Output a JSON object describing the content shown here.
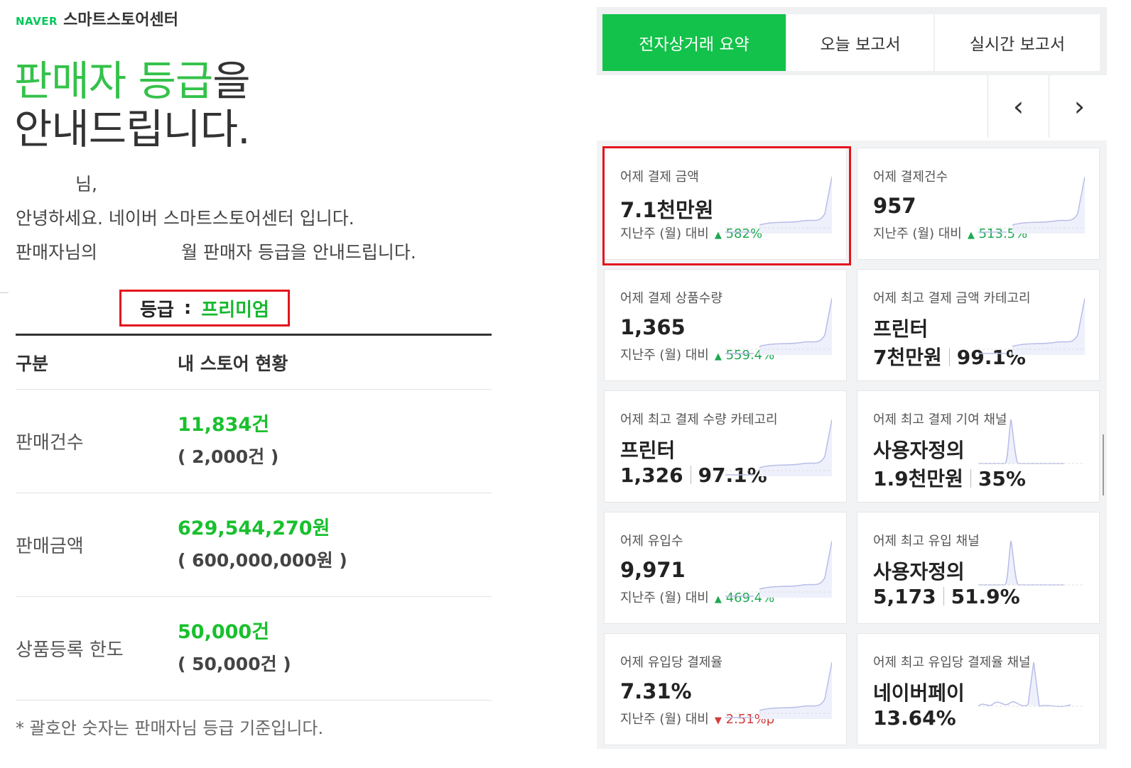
{
  "left": {
    "brand_naver": "NAVER",
    "brand_center": "스마트스토어센터",
    "headline_line1_green": "판매자 등급",
    "headline_line1_rest": "을",
    "headline_line2": "안내드립니다.",
    "greeting_name_suffix": "님,",
    "greeting_line2": "안녕하세요. 네이버 스마트스토어센터 입니다.",
    "greeting_line3_prefix": "판매자님의",
    "greeting_line3_suffix": "월 판매자 등급을 안내드립니다.",
    "grade_label": "등급",
    "grade_colon": ":",
    "grade_value": "프리미엄",
    "table": {
      "col1": "구분",
      "col2": "내 스토어 현황",
      "rows": [
        {
          "label": "판매건수",
          "value": "11,834건",
          "criteria": "( 2,000건 )"
        },
        {
          "label": "판매금액",
          "value": "629,544,270원",
          "criteria": "( 600,000,000원 )"
        },
        {
          "label": "상품등록 한도",
          "value": "50,000건",
          "criteria": "( 50,000건 )"
        }
      ]
    },
    "note": "* 괄호안 숫자는 판매자님 등급 기준입니다."
  },
  "right": {
    "tabs": [
      "전자상거래 요약",
      "오늘 보고서",
      "실시간 보고서"
    ],
    "prev_icon": "‹",
    "next_icon": "›",
    "cards": [
      {
        "label": "어제 결제 금액",
        "value": "7.1천만원",
        "cmp": "지난주 (월) 대비",
        "change": "582%",
        "dir": "up",
        "spark": "rise"
      },
      {
        "label": "어제 결제건수",
        "value": "957",
        "cmp": "지난주 (월) 대비",
        "change": "513.5%",
        "dir": "up",
        "spark": "rise"
      },
      {
        "label": "어제 결제 상품수량",
        "value": "1,365",
        "cmp": "지난주 (월) 대비",
        "change": "559.4%",
        "dir": "up",
        "spark": "rise"
      },
      {
        "label": "어제 최고 결제 금액 카테고리",
        "line2": "프린터",
        "line3a": "7천만원",
        "line3b": "99.1%",
        "spark": "rise"
      },
      {
        "label": "어제 최고 결제 수량 카테고리",
        "line2": "프린터",
        "line3a": "1,326",
        "line3b": "97.1%",
        "spark": "rise"
      },
      {
        "label": "어제 최고 결제 기여 채널",
        "line2": "사용자정의",
        "line3a": "1.9천만원",
        "line3b": "35%",
        "spark": "peak"
      },
      {
        "label": "어제 유입수",
        "value": "9,971",
        "cmp": "지난주 (월) 대비",
        "change": "469.4%",
        "dir": "up",
        "spark": "rise"
      },
      {
        "label": "어제 최고 유입 채널",
        "line2": "사용자정의",
        "line3a": "5,173",
        "line3b": "51.9%",
        "spark": "peak"
      },
      {
        "label": "어제 유입당 결제율",
        "value": "7.31%",
        "cmp": "지난주 (월) 대비",
        "change": "2.51%p",
        "dir": "down",
        "spark": "rise"
      },
      {
        "label": "어제 최고 유입당 결제율 채널",
        "line2": "네이버페이",
        "line3a": "13.64%",
        "line3b": "",
        "spark": "wiggle"
      }
    ]
  },
  "colors": {
    "accent_green": "#13c24a",
    "highlight_red": "#e3141d",
    "up_green": "#1ea851",
    "down_red": "#d23b3b"
  }
}
